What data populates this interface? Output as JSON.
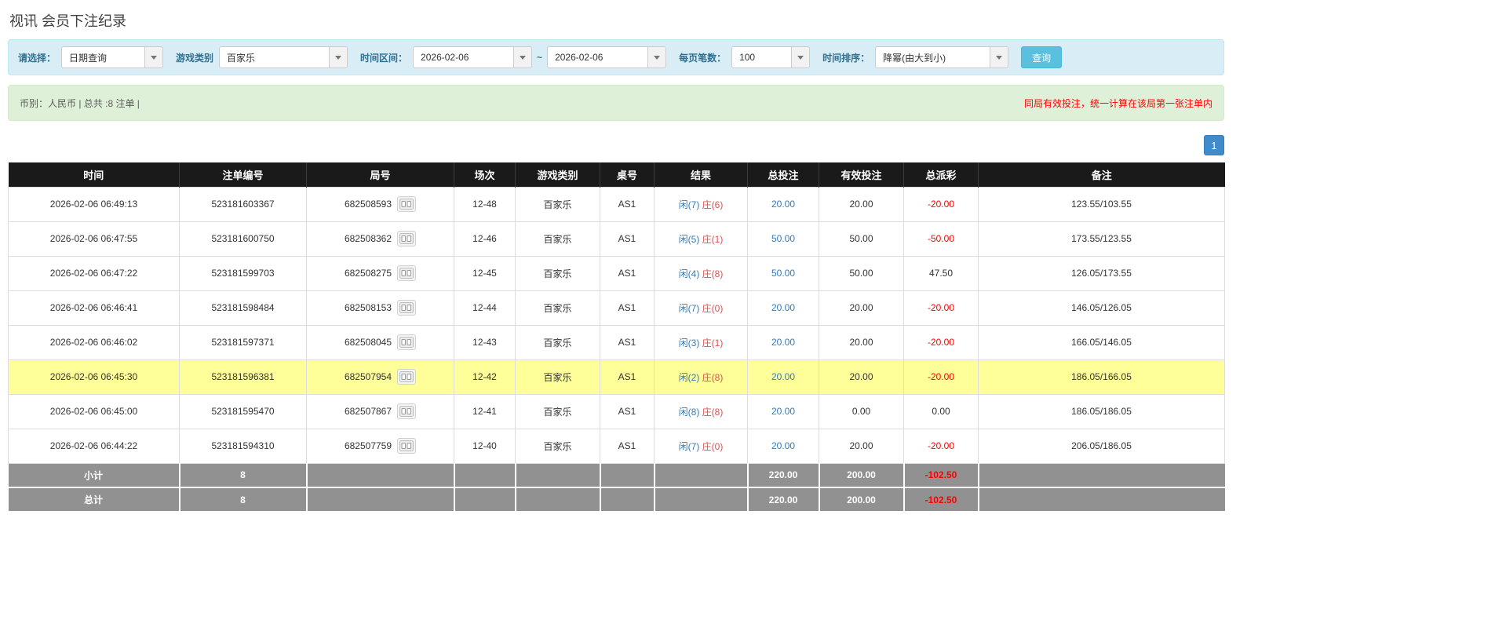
{
  "page": {
    "title": "视讯 会员下注纪录"
  },
  "filters": {
    "select_label": "请选择：",
    "select_value": "日期查询",
    "game_type_label": "游戏类别",
    "game_type_value": "百家乐",
    "time_range_label": "时间区间：",
    "date_from": "2026-02-06",
    "tilde": "~",
    "date_to": "2026-02-06",
    "per_page_label": "每页笔数：",
    "per_page_value": "100",
    "sort_label": "时间排序：",
    "sort_value": "降幂(由大到小)",
    "query_button": "查询"
  },
  "summary": {
    "left": "币别：人民币 | 总共 :8 注单 |",
    "right": "同局有效投注，统一计算在该局第一张注单内"
  },
  "pagination": {
    "page": "1"
  },
  "table": {
    "headers": [
      "时间",
      "注单编号",
      "局号",
      "场次",
      "游戏类别",
      "桌号",
      "结果",
      "总投注",
      "有效投注",
      "总派彩",
      "备注"
    ],
    "rows": [
      {
        "time": "2026-02-06 06:49:13",
        "bet_id": "523181603367",
        "round_id": "682508593",
        "session": "12-48",
        "game": "百家乐",
        "table_no": "AS1",
        "result_player": "闲(7)",
        "result_banker": "庄(6)",
        "total_bet": "20.00",
        "valid_bet": "20.00",
        "payout": "-20.00",
        "note": "123.55/103.55",
        "highlight": false
      },
      {
        "time": "2026-02-06 06:47:55",
        "bet_id": "523181600750",
        "round_id": "682508362",
        "session": "12-46",
        "game": "百家乐",
        "table_no": "AS1",
        "result_player": "闲(5)",
        "result_banker": "庄(1)",
        "total_bet": "50.00",
        "valid_bet": "50.00",
        "payout": "-50.00",
        "note": "173.55/123.55",
        "highlight": false
      },
      {
        "time": "2026-02-06 06:47:22",
        "bet_id": "523181599703",
        "round_id": "682508275",
        "session": "12-45",
        "game": "百家乐",
        "table_no": "AS1",
        "result_player": "闲(4)",
        "result_banker": "庄(8)",
        "total_bet": "50.00",
        "valid_bet": "50.00",
        "payout": "47.50",
        "note": "126.05/173.55",
        "highlight": false
      },
      {
        "time": "2026-02-06 06:46:41",
        "bet_id": "523181598484",
        "round_id": "682508153",
        "session": "12-44",
        "game": "百家乐",
        "table_no": "AS1",
        "result_player": "闲(7)",
        "result_banker": "庄(0)",
        "total_bet": "20.00",
        "valid_bet": "20.00",
        "payout": "-20.00",
        "note": "146.05/126.05",
        "highlight": false
      },
      {
        "time": "2026-02-06 06:46:02",
        "bet_id": "523181597371",
        "round_id": "682508045",
        "session": "12-43",
        "game": "百家乐",
        "table_no": "AS1",
        "result_player": "闲(3)",
        "result_banker": "庄(1)",
        "total_bet": "20.00",
        "valid_bet": "20.00",
        "payout": "-20.00",
        "note": "166.05/146.05",
        "highlight": false
      },
      {
        "time": "2026-02-06 06:45:30",
        "bet_id": "523181596381",
        "round_id": "682507954",
        "session": "12-42",
        "game": "百家乐",
        "table_no": "AS1",
        "result_player": "闲(2)",
        "result_banker": "庄(8)",
        "total_bet": "20.00",
        "valid_bet": "20.00",
        "payout": "-20.00",
        "note": "186.05/166.05",
        "highlight": true
      },
      {
        "time": "2026-02-06 06:45:00",
        "bet_id": "523181595470",
        "round_id": "682507867",
        "session": "12-41",
        "game": "百家乐",
        "table_no": "AS1",
        "result_player": "闲(8)",
        "result_banker": "庄(8)",
        "total_bet": "20.00",
        "valid_bet": "0.00",
        "payout": "0.00",
        "note": "186.05/186.05",
        "highlight": false
      },
      {
        "time": "2026-02-06 06:44:22",
        "bet_id": "523181594310",
        "round_id": "682507759",
        "session": "12-40",
        "game": "百家乐",
        "table_no": "AS1",
        "result_player": "闲(7)",
        "result_banker": "庄(0)",
        "total_bet": "20.00",
        "valid_bet": "20.00",
        "payout": "-20.00",
        "note": "206.05/186.05",
        "highlight": false
      }
    ],
    "subtotal": {
      "label": "小计",
      "count": "8",
      "total_bet": "220.00",
      "valid_bet": "200.00",
      "payout": "-102.50"
    },
    "total": {
      "label": "总计",
      "count": "8",
      "total_bet": "220.00",
      "valid_bet": "200.00",
      "payout": "-102.50"
    }
  },
  "icons": {
    "round_detail": "cards-icon",
    "combo_caret": "chevron-down-icon"
  },
  "colors": {
    "filter_bg": "#d9edf7",
    "filter_label": "#31708f",
    "query_button": "#5bc0de",
    "summary_bg": "#dff0d8",
    "warning_text": "#ff0000",
    "header_bg": "#1a1a1a",
    "footer_bg": "#919191",
    "highlight_row": "#ffff99",
    "link_blue": "#337ab7",
    "player_blue": "#337ab7",
    "banker_red": "#d9534f",
    "negative_red": "#ff0000",
    "pagination_blue": "#428bca"
  }
}
